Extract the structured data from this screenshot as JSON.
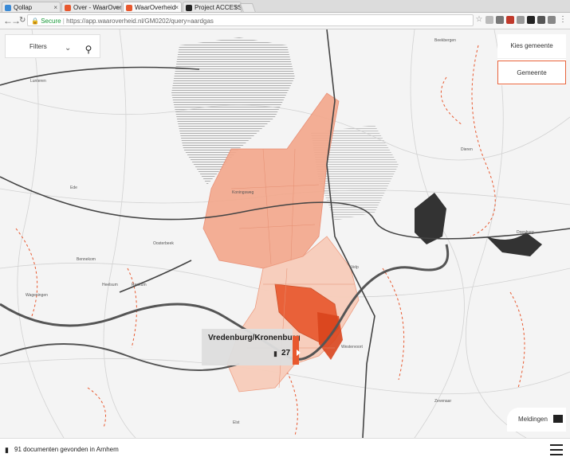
{
  "browser": {
    "tabs": [
      {
        "label": "Qollap",
        "color": "#3a8ad6",
        "active": false
      },
      {
        "label": "Over - WaarOverheid",
        "color": "#e8582e",
        "active": false
      },
      {
        "label": "WaarOverheid",
        "color": "#e8582e",
        "active": true
      },
      {
        "label": "Project ACCESS rese",
        "color": "#222222",
        "active": false
      }
    ],
    "close_glyph": "×",
    "back_icon": "back-arrow-icon",
    "forward_icon": "forward-arrow-icon",
    "reload_icon": "reload-icon",
    "secure_label": "Secure",
    "url": "https://app.waaroverheid.nl/GM0202/query=aardgas"
  },
  "map_controls": {
    "filter_label": "Filters",
    "chevron_glyph": "⌄",
    "pin_glyph": "⚲",
    "choose_municipality": "Kies gemeente",
    "municipality_button": "Gemeente"
  },
  "tooltip": {
    "title": "Vredenburg/Kronenburg",
    "count": "27",
    "doc_glyph": "▮"
  },
  "map_labels": [
    "Ellecom",
    "Dieren",
    "Doesburg",
    "Velp",
    "Westervoort",
    "Zevenaar",
    "Renkum",
    "Oosterbeek",
    "Wageningen",
    "Ede",
    "Lunteren",
    "Elst",
    "Koningsweg",
    "Bennekom",
    "Heelsum",
    "Beekbergen"
  ],
  "notifications": {
    "label": "Meldingen"
  },
  "status_bar": {
    "text": "91 documenten gevonden in Arnhem"
  },
  "colors": {
    "accent": "#e8582e",
    "region_light": "#f3b49c",
    "region_dark": "#e8582e"
  }
}
